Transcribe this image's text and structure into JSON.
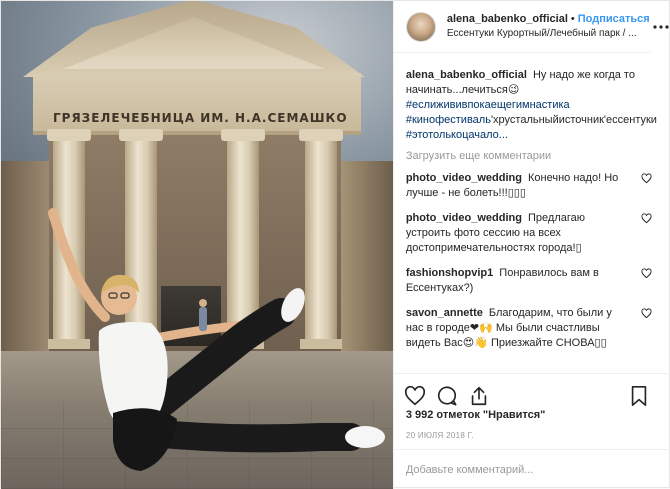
{
  "post": {
    "photo": {
      "building_sign": "ГРЯЗЕЛЕЧЕБНИЦА ИМ. Н.А.СЕМАШКО"
    },
    "header": {
      "username": "alena_babenko_official",
      "separator": "•",
      "follow_label": "Подписаться",
      "location": "Ессентуки Курортный/Лечебный парк / ..."
    },
    "caption": {
      "username": "alena_babenko_official",
      "text": "Ну надо же когда то начинать...лечиться😉",
      "hashtags": [
        "#еслижививпокаещегимнастика",
        "#кинофестиваль",
        "#этотолькоцачало..."
      ],
      "mid_text": "'хрустальныйисточник'ессентуки"
    },
    "load_more_label": "Загрузить еще комментарии",
    "comments": [
      {
        "username": "photo_video_wedding",
        "text": "Конечно надо! Но лучше - не болеть!!!▯▯▯"
      },
      {
        "username": "photo_video_wedding",
        "text": "Предлагаю устроить фото сессию на всех достопримечательностях города!▯"
      },
      {
        "username": "fashionshopvip1",
        "text": "Понравилось вам в Ессентуках?)"
      },
      {
        "username": "savon_annette",
        "text": "Благодарим, что были у нас в городе❤🙌 Мы были счастливы видеть Вас😍👋 Приезжайте СНОВА▯▯"
      }
    ],
    "actions": {
      "like_icon": "heart-icon",
      "comment_icon": "comment-icon",
      "share_icon": "share-icon",
      "save_icon": "bookmark-icon"
    },
    "likes_text": "3 992 отметок \"Нравится\"",
    "date": "20 ИЮЛЯ 2018 Г.",
    "add_comment_placeholder": "Добавьте комментарий...",
    "colors": {
      "link_blue": "#3897f0",
      "hashtag_blue": "#003569",
      "muted_gray": "#999999",
      "border": "#efefef"
    }
  }
}
